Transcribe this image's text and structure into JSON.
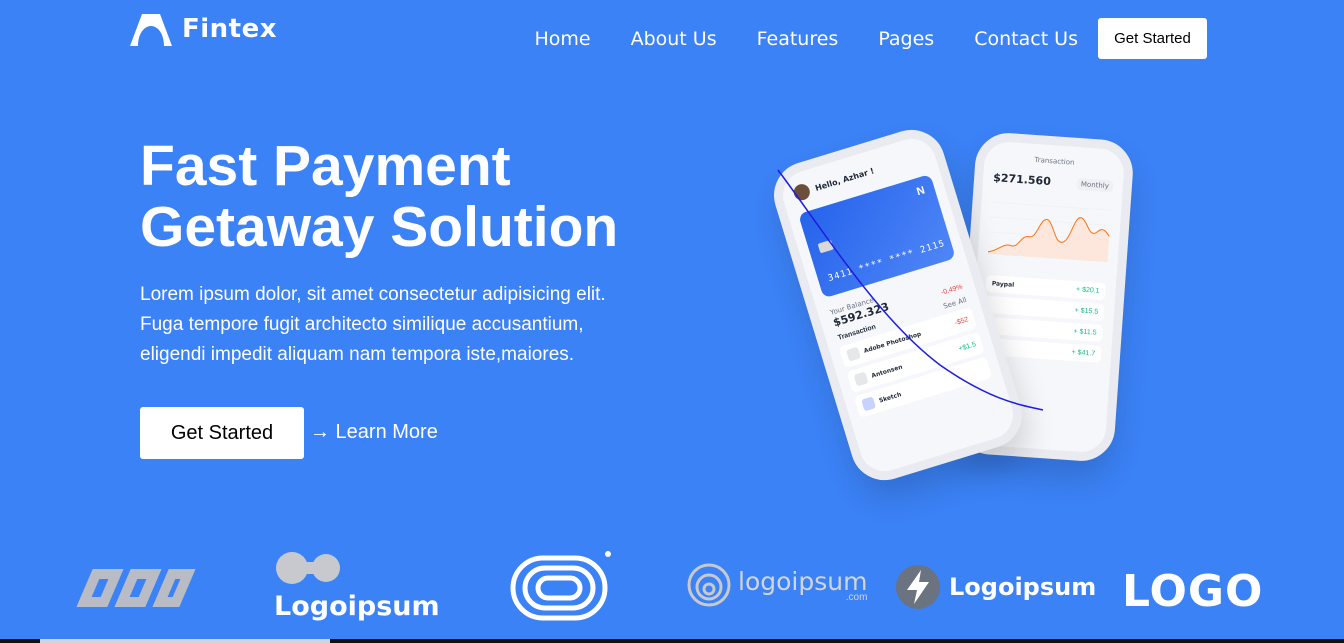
{
  "brand": {
    "name": "Fintex",
    "icon": "fintex-logo-icon"
  },
  "nav": {
    "items": [
      "Home",
      "About Us",
      "Features",
      "Pages",
      "Contact Us"
    ],
    "cta_label": "Get Started"
  },
  "hero": {
    "title_line1": "Fast Payment",
    "title_line2": "Getaway Solution",
    "desc_line1": "Lorem ipsum dolor, sit amet consectetur adipisicing elit.",
    "desc_line2": "Fuga tempore fugit architecto similique accusantium,",
    "desc_line3": "eligendi impedit aliquam nam tempora iste,maiores.",
    "primary_label": "Get Started",
    "secondary_label": "→ Learn More"
  },
  "phone_front": {
    "greeting": "Hello, Azhar !",
    "card_number": "3411  ****  ****  2115",
    "balance_label": "Your Balance",
    "balance": "$592.323",
    "change": "-0.49%",
    "see_all": "See All",
    "transactions_title": "Transaction",
    "transactions": [
      {
        "name": "Adobe Photoshop",
        "amount": "-$52"
      },
      {
        "name": "Antonsen",
        "amount": "+$1.5"
      },
      {
        "name": "Sketch",
        "amount": ""
      }
    ]
  },
  "phone_back": {
    "title": "Transaction",
    "amount": "$271.560",
    "period": "Monthly",
    "items": [
      {
        "name": "Paypal",
        "amount": "+ $20.1"
      },
      {
        "name": "",
        "amount": "+ $15.5"
      },
      {
        "name": "",
        "amount": "+ $11.5"
      },
      {
        "name": "",
        "amount": "+ $41.7"
      }
    ]
  },
  "logos": {
    "logo2_text": "Logoipsum",
    "logo4_text": "logoipsum",
    "logo4_sub": ".com",
    "logo5_text": "Logoipsum",
    "logo6_text": "LOGO"
  },
  "colors": {
    "background": "#3b82f6",
    "accent_white": "#ffffff"
  }
}
